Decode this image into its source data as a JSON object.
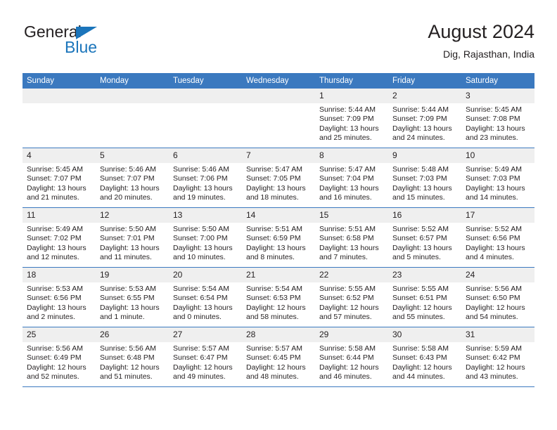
{
  "logo": {
    "word1": "General",
    "word2": "Blue",
    "triangle_color": "#1b75bb"
  },
  "header": {
    "title": "August 2024",
    "subtitle": "Dig, Rajasthan, India",
    "header_bg": "#3b79bf",
    "daynum_bg": "#efefef"
  },
  "calendar": {
    "weekday_headers": [
      "Sunday",
      "Monday",
      "Tuesday",
      "Wednesday",
      "Thursday",
      "Friday",
      "Saturday"
    ],
    "labels": {
      "sunrise": "Sunrise:",
      "sunset": "Sunset:",
      "daylight": "Daylight:"
    },
    "weeks": [
      [
        {
          "day": "",
          "empty": true
        },
        {
          "day": "",
          "empty": true
        },
        {
          "day": "",
          "empty": true
        },
        {
          "day": "",
          "empty": true
        },
        {
          "day": "1",
          "sunrise": "Sunrise: 5:44 AM",
          "sunset": "Sunset: 7:09 PM",
          "daylight": "Daylight: 13 hours and 25 minutes."
        },
        {
          "day": "2",
          "sunrise": "Sunrise: 5:44 AM",
          "sunset": "Sunset: 7:09 PM",
          "daylight": "Daylight: 13 hours and 24 minutes."
        },
        {
          "day": "3",
          "sunrise": "Sunrise: 5:45 AM",
          "sunset": "Sunset: 7:08 PM",
          "daylight": "Daylight: 13 hours and 23 minutes."
        }
      ],
      [
        {
          "day": "4",
          "sunrise": "Sunrise: 5:45 AM",
          "sunset": "Sunset: 7:07 PM",
          "daylight": "Daylight: 13 hours and 21 minutes."
        },
        {
          "day": "5",
          "sunrise": "Sunrise: 5:46 AM",
          "sunset": "Sunset: 7:07 PM",
          "daylight": "Daylight: 13 hours and 20 minutes."
        },
        {
          "day": "6",
          "sunrise": "Sunrise: 5:46 AM",
          "sunset": "Sunset: 7:06 PM",
          "daylight": "Daylight: 13 hours and 19 minutes."
        },
        {
          "day": "7",
          "sunrise": "Sunrise: 5:47 AM",
          "sunset": "Sunset: 7:05 PM",
          "daylight": "Daylight: 13 hours and 18 minutes."
        },
        {
          "day": "8",
          "sunrise": "Sunrise: 5:47 AM",
          "sunset": "Sunset: 7:04 PM",
          "daylight": "Daylight: 13 hours and 16 minutes."
        },
        {
          "day": "9",
          "sunrise": "Sunrise: 5:48 AM",
          "sunset": "Sunset: 7:03 PM",
          "daylight": "Daylight: 13 hours and 15 minutes."
        },
        {
          "day": "10",
          "sunrise": "Sunrise: 5:49 AM",
          "sunset": "Sunset: 7:03 PM",
          "daylight": "Daylight: 13 hours and 14 minutes."
        }
      ],
      [
        {
          "day": "11",
          "sunrise": "Sunrise: 5:49 AM",
          "sunset": "Sunset: 7:02 PM",
          "daylight": "Daylight: 13 hours and 12 minutes."
        },
        {
          "day": "12",
          "sunrise": "Sunrise: 5:50 AM",
          "sunset": "Sunset: 7:01 PM",
          "daylight": "Daylight: 13 hours and 11 minutes."
        },
        {
          "day": "13",
          "sunrise": "Sunrise: 5:50 AM",
          "sunset": "Sunset: 7:00 PM",
          "daylight": "Daylight: 13 hours and 10 minutes."
        },
        {
          "day": "14",
          "sunrise": "Sunrise: 5:51 AM",
          "sunset": "Sunset: 6:59 PM",
          "daylight": "Daylight: 13 hours and 8 minutes."
        },
        {
          "day": "15",
          "sunrise": "Sunrise: 5:51 AM",
          "sunset": "Sunset: 6:58 PM",
          "daylight": "Daylight: 13 hours and 7 minutes."
        },
        {
          "day": "16",
          "sunrise": "Sunrise: 5:52 AM",
          "sunset": "Sunset: 6:57 PM",
          "daylight": "Daylight: 13 hours and 5 minutes."
        },
        {
          "day": "17",
          "sunrise": "Sunrise: 5:52 AM",
          "sunset": "Sunset: 6:56 PM",
          "daylight": "Daylight: 13 hours and 4 minutes."
        }
      ],
      [
        {
          "day": "18",
          "sunrise": "Sunrise: 5:53 AM",
          "sunset": "Sunset: 6:56 PM",
          "daylight": "Daylight: 13 hours and 2 minutes."
        },
        {
          "day": "19",
          "sunrise": "Sunrise: 5:53 AM",
          "sunset": "Sunset: 6:55 PM",
          "daylight": "Daylight: 13 hours and 1 minute."
        },
        {
          "day": "20",
          "sunrise": "Sunrise: 5:54 AM",
          "sunset": "Sunset: 6:54 PM",
          "daylight": "Daylight: 13 hours and 0 minutes."
        },
        {
          "day": "21",
          "sunrise": "Sunrise: 5:54 AM",
          "sunset": "Sunset: 6:53 PM",
          "daylight": "Daylight: 12 hours and 58 minutes."
        },
        {
          "day": "22",
          "sunrise": "Sunrise: 5:55 AM",
          "sunset": "Sunset: 6:52 PM",
          "daylight": "Daylight: 12 hours and 57 minutes."
        },
        {
          "day": "23",
          "sunrise": "Sunrise: 5:55 AM",
          "sunset": "Sunset: 6:51 PM",
          "daylight": "Daylight: 12 hours and 55 minutes."
        },
        {
          "day": "24",
          "sunrise": "Sunrise: 5:56 AM",
          "sunset": "Sunset: 6:50 PM",
          "daylight": "Daylight: 12 hours and 54 minutes."
        }
      ],
      [
        {
          "day": "25",
          "sunrise": "Sunrise: 5:56 AM",
          "sunset": "Sunset: 6:49 PM",
          "daylight": "Daylight: 12 hours and 52 minutes."
        },
        {
          "day": "26",
          "sunrise": "Sunrise: 5:56 AM",
          "sunset": "Sunset: 6:48 PM",
          "daylight": "Daylight: 12 hours and 51 minutes."
        },
        {
          "day": "27",
          "sunrise": "Sunrise: 5:57 AM",
          "sunset": "Sunset: 6:47 PM",
          "daylight": "Daylight: 12 hours and 49 minutes."
        },
        {
          "day": "28",
          "sunrise": "Sunrise: 5:57 AM",
          "sunset": "Sunset: 6:45 PM",
          "daylight": "Daylight: 12 hours and 48 minutes."
        },
        {
          "day": "29",
          "sunrise": "Sunrise: 5:58 AM",
          "sunset": "Sunset: 6:44 PM",
          "daylight": "Daylight: 12 hours and 46 minutes."
        },
        {
          "day": "30",
          "sunrise": "Sunrise: 5:58 AM",
          "sunset": "Sunset: 6:43 PM",
          "daylight": "Daylight: 12 hours and 44 minutes."
        },
        {
          "day": "31",
          "sunrise": "Sunrise: 5:59 AM",
          "sunset": "Sunset: 6:42 PM",
          "daylight": "Daylight: 12 hours and 43 minutes."
        }
      ]
    ]
  }
}
